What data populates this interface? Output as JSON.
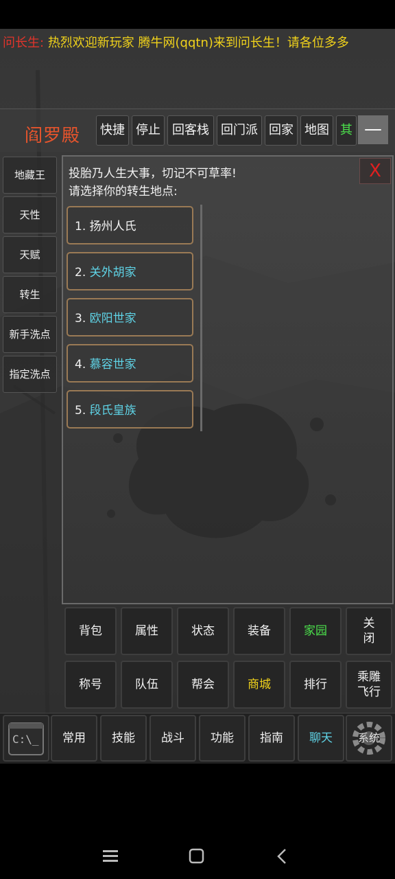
{
  "ticker": {
    "speaker": "问长生:",
    "message": "热烈欢迎新玩家  腾牛网(qqtn)来到问长生！请各位多多"
  },
  "header": {
    "title": "阎罗殿",
    "buttons": [
      "快捷",
      "停止",
      "回客栈",
      "回门派",
      "回家",
      "地图",
      "其"
    ],
    "minimize": "—"
  },
  "sidebar": {
    "items": [
      "地藏王",
      "天性",
      "天赋",
      "转生",
      "新手洗点",
      "指定洗点"
    ]
  },
  "dialog": {
    "line1": "投胎乃人生大事，切记不可草率!",
    "line2": "请选择你的转生地点:",
    "close": "X",
    "options": [
      {
        "num": "1.",
        "name": "扬州人氏"
      },
      {
        "num": "2.",
        "name": "关外胡家"
      },
      {
        "num": "3.",
        "name": "欧阳世家"
      },
      {
        "num": "4.",
        "name": "慕容世家"
      },
      {
        "num": "5.",
        "name": "段氏皇族"
      }
    ]
  },
  "menu": {
    "row1": [
      "背包",
      "属性",
      "状态",
      "装备",
      "家园",
      "关闭"
    ],
    "row2": [
      "称号",
      "队伍",
      "帮会",
      "商城",
      "排行",
      "乘雕飞行"
    ]
  },
  "bottom_tabs": {
    "console_icon_text": "C:\\_",
    "tabs": [
      "常用",
      "技能",
      "战斗",
      "功能",
      "指南",
      "聊天"
    ],
    "system": "系统"
  },
  "colors": {
    "title": "#e6542c",
    "highlight_green": "#4be04b",
    "highlight_yellow": "#f0d21b",
    "cyan": "#5fd3e6",
    "close_red": "#e02020"
  }
}
